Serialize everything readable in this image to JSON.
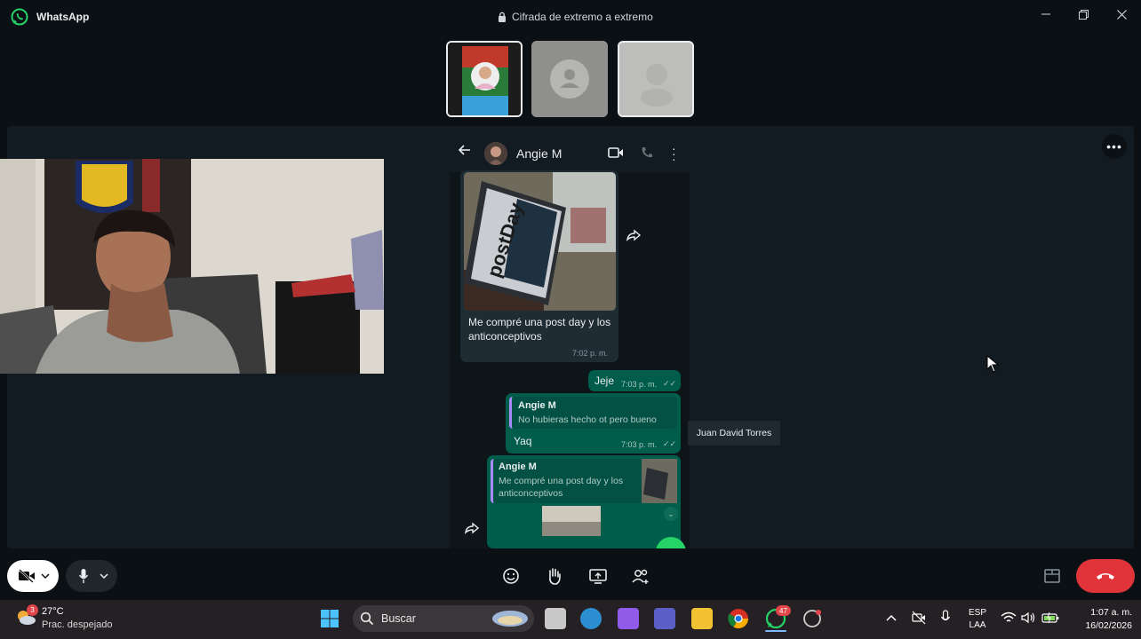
{
  "titlebar": {
    "app_name": "WhatsApp",
    "encryption_label": "Cifrada de extremo a extremo"
  },
  "colors": {
    "accent_green": "#25d366",
    "outgoing_bubble": "#005c4b",
    "end_call_red": "#e0343a",
    "background": "#0b1014"
  },
  "participants": [
    {
      "kind": "photo",
      "selected": true
    },
    {
      "kind": "default-avatar",
      "selected": false
    },
    {
      "kind": "blurred",
      "selected": true
    }
  ],
  "shared_screen": {
    "contact_name": "Angie M",
    "messages": {
      "incoming_image_text": "postDay",
      "incoming_caption": "Me compré una post day y los anticonceptivos",
      "incoming_time": "7:02 p. m.",
      "out1_text": "Jeje",
      "out1_time": "7:03 p. m.",
      "out2_quote_name": "Angie M",
      "out2_quote_text": "No hubieras hecho ot pero bueno",
      "out2_text": "Yaq",
      "out2_time": "7:03 p. m.",
      "out3_quote_name": "Angie M",
      "out3_quote_text": "Me compré una post day y los anticonceptivos"
    }
  },
  "tooltip": "Juan David Torres",
  "icons": [
    "whatsapp-logo-icon",
    "lock-icon",
    "minimize-icon",
    "maximize-icon",
    "close-icon",
    "more-icon",
    "camera-off-icon",
    "mic-icon",
    "chevron-down-icon",
    "emoji-icon",
    "raise-hand-icon",
    "screen-share-icon",
    "participants-icon",
    "layout-icon",
    "end-call-icon"
  ],
  "taskbar": {
    "weather_temp": "27°C",
    "weather_desc": "Prac. despejado",
    "weather_badge": "3",
    "search_label": "Buscar",
    "whatsapp_badge": "47",
    "lang_line1": "ESP",
    "lang_line2": "LAA",
    "time": "1:07 a. m.",
    "date": "16/02/2026"
  }
}
